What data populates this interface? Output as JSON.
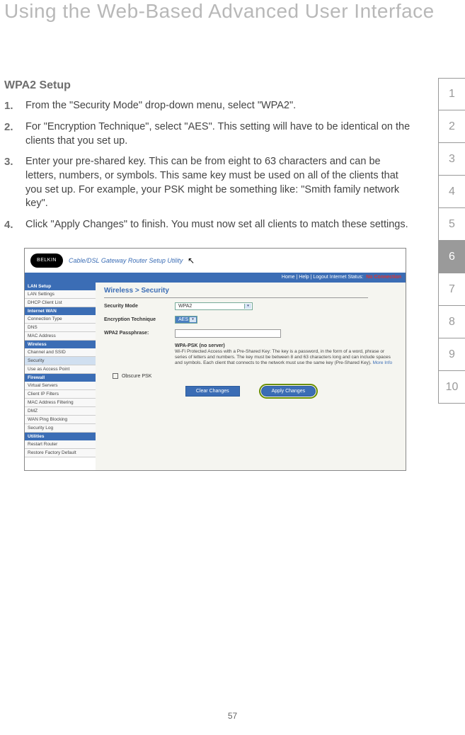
{
  "page_title": "Using the Web-Based Advanced User Interface",
  "page_number": "57",
  "tabs": [
    "1",
    "2",
    "3",
    "4",
    "5",
    "6",
    "7",
    "8",
    "9",
    "10"
  ],
  "active_tab_index": 5,
  "section_heading": "WPA2 Setup",
  "steps": [
    {
      "num": "1.",
      "text": "From the \"Security Mode\" drop-down menu, select \"WPA2\"."
    },
    {
      "num": "2.",
      "text": "For \"Encryption Technique\", select \"AES\". This setting will have to be identical on the clients that you set up."
    },
    {
      "num": "3.",
      "text": "Enter your pre-shared key. This can be from eight to 63 characters and can be letters, numbers, or symbols. This same key must be used on all of the clients that you set up. For example, your PSK might be something like: \"Smith family network key\"."
    },
    {
      "num": "4.",
      "text": "Click \"Apply Changes\" to finish. You must now set all clients to match these settings."
    }
  ],
  "screenshot": {
    "logo": "BELKIN",
    "header_text": "Cable/DSL Gateway Router Setup Utility",
    "bluebar_links": "Home | Help | Logout    Internet Status:",
    "bluebar_status": "No Connection",
    "sidebar": {
      "sections": [
        {
          "title": "LAN Setup",
          "items": [
            "LAN Settings",
            "DHCP Client List"
          ]
        },
        {
          "title": "Internet WAN",
          "items": [
            "Connection Type",
            "DNS",
            "MAC Address"
          ]
        },
        {
          "title": "Wireless",
          "items": [
            "Channel and SSID",
            "Security",
            "Use as Access Point"
          ]
        },
        {
          "title": "Firewall",
          "items": [
            "Virtual Servers",
            "Client IP Filters",
            "MAC Address Filtering",
            "DMZ",
            "WAN Ping Blocking",
            "Security Log"
          ]
        },
        {
          "title": "Utilities",
          "items": [
            "Restart Router",
            "Restore Factory Default"
          ]
        }
      ],
      "selected": "Security"
    },
    "breadcrumb": "Wireless > Security",
    "form": {
      "security_mode_label": "Security Mode",
      "security_mode_value": "WPA2",
      "encryption_label": "Encryption Technique",
      "encryption_value": "AES",
      "passphrase_label": "WPA2 Passphrase:",
      "desc_title": "WPA-PSK (no server)",
      "desc_body": "Wi-Fi Protected Access with a Pre-Shared Key: The key is a password, in the form of a word, phrase or series of letters and numbers. The key must be between 8 and 63 characters long and can include spaces and symbols. Each client that connects to the network must use the same key (Pre-Shared Key).",
      "desc_more": "More Info",
      "obscure_label": "Obscure PSK",
      "clear_btn": "Clear Changes",
      "apply_btn": "Apply Changes"
    }
  }
}
